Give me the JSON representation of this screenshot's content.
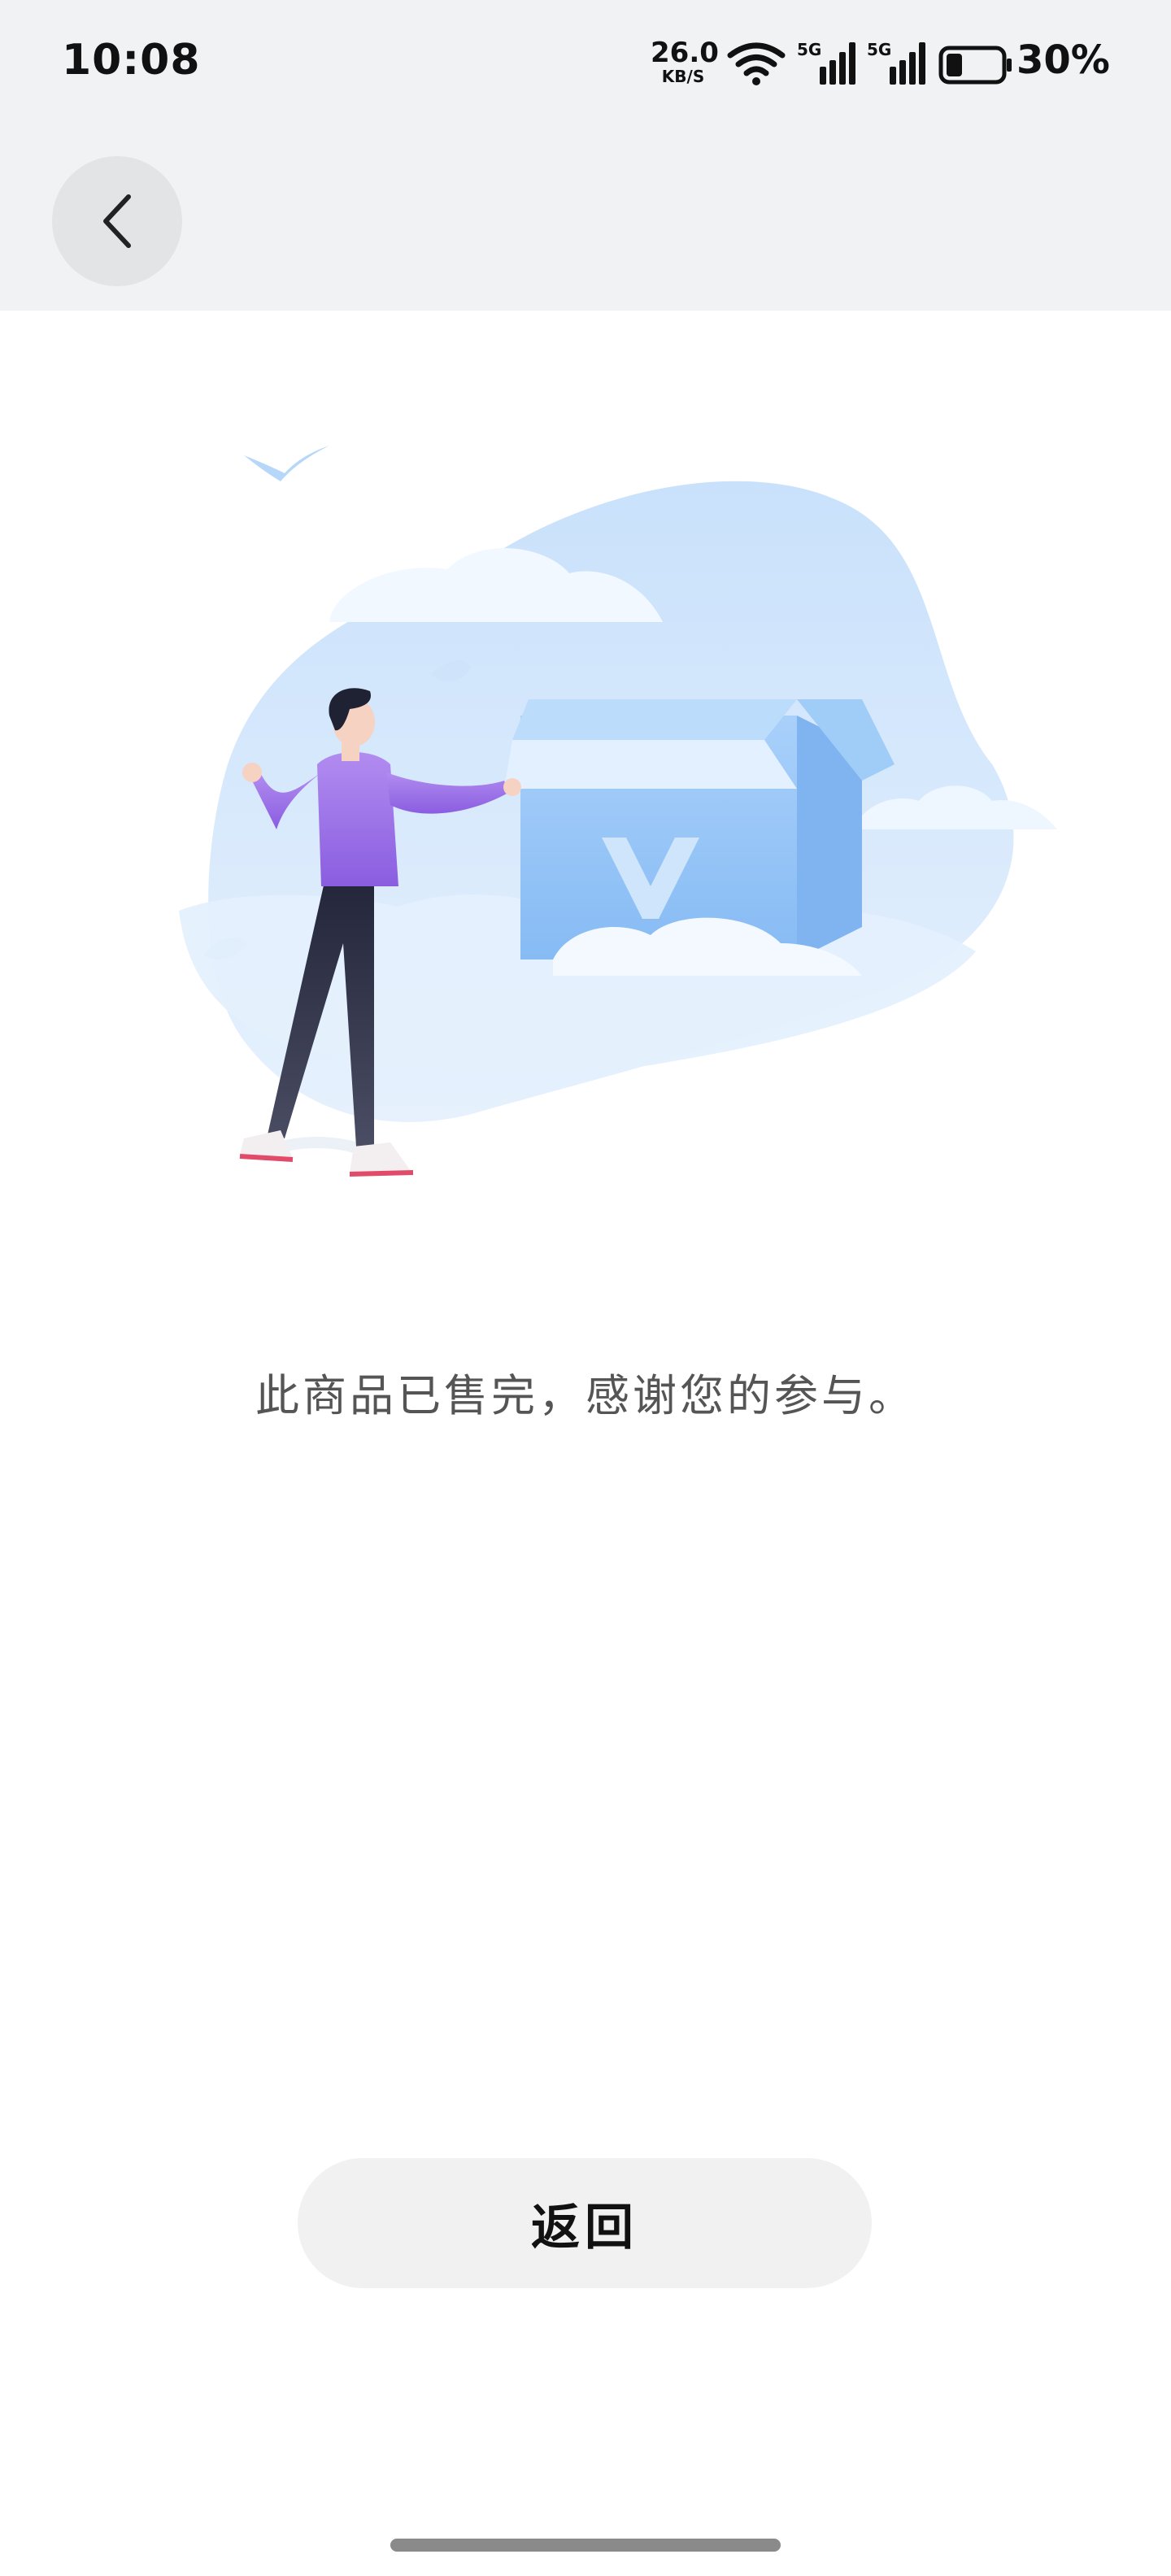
{
  "status_bar": {
    "time": "10:08",
    "net_speed_value": "26.0",
    "net_speed_unit": "KB/S",
    "signal_label_1": "5G",
    "signal_label_2": "5G",
    "battery_percent": "30%",
    "battery_level": 0.3
  },
  "header": {
    "back_icon": "chevron-left-icon"
  },
  "content": {
    "message": "此商品已售完，感谢您的参与。",
    "return_button": "返回"
  },
  "colors": {
    "top_bg": "#f1f2f4",
    "blob": "#cfe4fb",
    "box": "#9cc8f7",
    "sweater": "#9b6fe0",
    "pants": "#2f3144"
  }
}
